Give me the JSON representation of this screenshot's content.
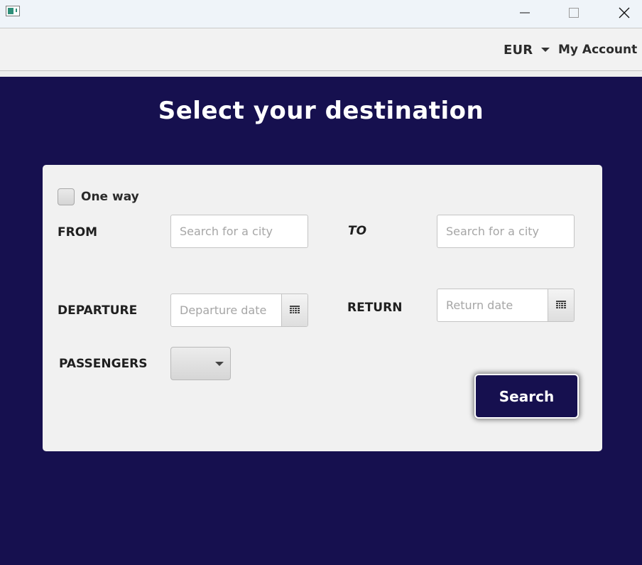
{
  "window": {
    "minimize_icon": "minimize-icon",
    "maximize_icon": "maximize-icon",
    "close_icon": "close-icon"
  },
  "header": {
    "currency": "EUR",
    "account": "My Account"
  },
  "main": {
    "title": "Select your destination",
    "one_way_label": "One way",
    "from_label": "FROM",
    "to_label": "TO",
    "departure_label": "DEPARTURE",
    "return_label": "RETURN",
    "passengers_label": "PASSENGERS",
    "from_placeholder": "Search for a city",
    "to_placeholder": "Search for a city",
    "departure_placeholder": "Departure date",
    "return_placeholder": "Return date",
    "passengers_value": "",
    "search_label": "Search"
  },
  "colors": {
    "background": "#16104f",
    "card": "#f1f1f1",
    "button": "#16104f"
  }
}
